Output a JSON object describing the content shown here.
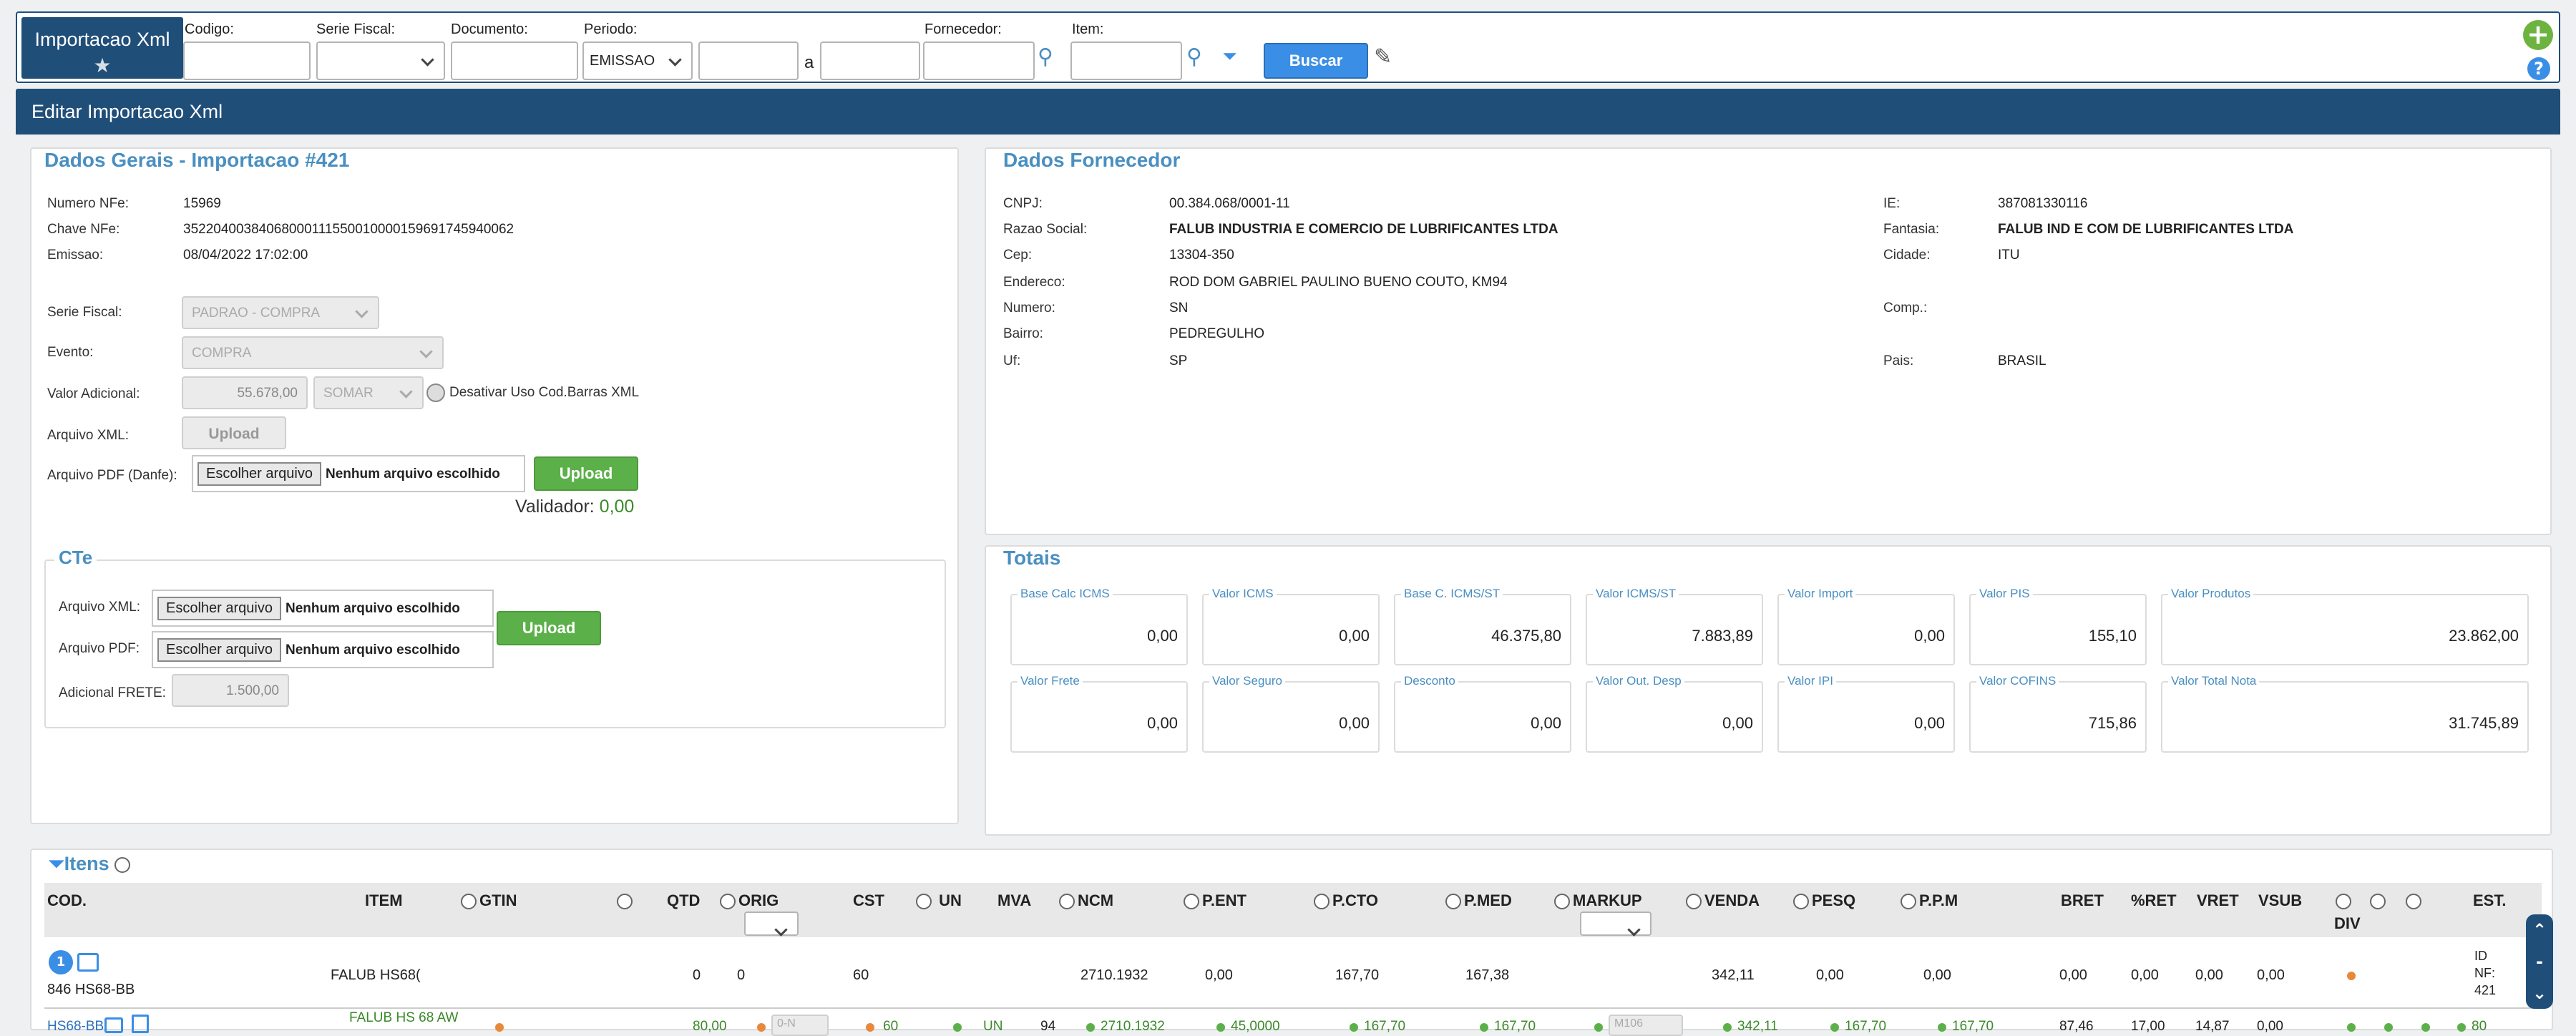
{
  "app": {
    "title": "Importacao Xml"
  },
  "filters": {
    "codigo_label": "Codigo:",
    "serie_label": "Serie Fiscal:",
    "documento_label": "Documento:",
    "periodo_label": "Periodo:",
    "periodo_value": "EMISSAO",
    "a_label": "a",
    "fornecedor_label": "Fornecedor:",
    "item_label": "Item:",
    "buscar": "Buscar"
  },
  "header": {
    "title": "Editar Importacao Xml"
  },
  "dados_gerais": {
    "title": "Dados Gerais - Importacao #421",
    "numero_label": "Numero NFe:",
    "numero": "15969",
    "chave_label": "Chave NFe:",
    "chave": "35220400384068000111550010000159691745940062",
    "emissao_label": "Emissao:",
    "emissao": "08/04/2022 17:02:00",
    "serie_label": "Serie Fiscal:",
    "serie": "PADRAO - COMPRA",
    "evento_label": "Evento:",
    "evento": "COMPRA",
    "valor_adic_label": "Valor Adicional:",
    "valor_adic": "55.678,00",
    "somar": "SOMAR",
    "desativar": "Desativar Uso Cod.Barras XML",
    "arquivo_xml_label": "Arquivo XML:",
    "upload": "Upload",
    "arquivo_pdf_label": "Arquivo PDF (Danfe):",
    "choose": "Escolher arquivo",
    "none": "Nenhum arquivo escolhido",
    "validador_label": "Validador:",
    "validador": "0,00"
  },
  "cte": {
    "title": "CTe",
    "xml_label": "Arquivo XML:",
    "pdf_label": "Arquivo PDF:",
    "frete_label": "Adicional FRETE:",
    "frete": "1.500,00",
    "upload": "Upload"
  },
  "fornecedor": {
    "title": "Dados Fornecedor",
    "cnpj_label": "CNPJ:",
    "cnpj": "00.384.068/0001-11",
    "razao_label": "Razao Social:",
    "razao": "FALUB INDUSTRIA E COMERCIO DE LUBRIFICANTES LTDA",
    "cep_label": "Cep:",
    "cep": "13304-350",
    "end_label": "Endereco:",
    "end": "ROD DOM GABRIEL PAULINO BUENO COUTO, KM94",
    "numero_label": "Numero:",
    "numero": "SN",
    "bairro_label": "Bairro:",
    "bairro": "PEDREGULHO",
    "uf_label": "Uf:",
    "uf": "SP",
    "ie_label": "IE:",
    "ie": "387081330116",
    "fantasia_label": "Fantasia:",
    "fantasia": "FALUB IND E COM DE LUBRIFICANTES LTDA",
    "cidade_label": "Cidade:",
    "cidade": "ITU",
    "comp_label": "Comp.:",
    "pais_label": "Pais:",
    "pais": "BRASIL"
  },
  "totais": {
    "title": "Totais",
    "boxes": [
      {
        "label": "Base Calc ICMS",
        "value": "0,00"
      },
      {
        "label": "Valor ICMS",
        "value": "0,00"
      },
      {
        "label": "Base C. ICMS/ST",
        "value": "46.375,80"
      },
      {
        "label": "Valor ICMS/ST",
        "value": "7.883,89"
      },
      {
        "label": "Valor Import",
        "value": "0,00"
      },
      {
        "label": "Valor PIS",
        "value": "155,10"
      },
      {
        "label": "Valor Produtos",
        "value": "23.862,00"
      },
      {
        "label": "Valor Frete",
        "value": "0,00"
      },
      {
        "label": "Valor Seguro",
        "value": "0,00"
      },
      {
        "label": "Desconto",
        "value": "0,00"
      },
      {
        "label": "Valor Out. Desp",
        "value": "0,00"
      },
      {
        "label": "Valor IPI",
        "value": "0,00"
      },
      {
        "label": "Valor COFINS",
        "value": "715,86"
      },
      {
        "label": "Valor Total Nota",
        "value": "31.745,89"
      }
    ]
  },
  "itens": {
    "title": "Itens",
    "columns": [
      "COD.",
      "ITEM",
      "GTIN",
      "QTD",
      "ORIG",
      "CST",
      "UN",
      "MVA",
      "NCM",
      "P.ENT",
      "P.CTO",
      "P.MED",
      "MARKUP",
      "VENDA",
      "PESQ",
      "P.P.M",
      "BRET",
      "%RET",
      "VRET",
      "VSUB",
      "DIV",
      "EST."
    ],
    "row1": {
      "badge": "1",
      "cod": "846 HS68-BB",
      "item": "FALUB HS68(",
      "gtin": "0",
      "qtd": "0",
      "cst": "60",
      "ncm": "2710.1932",
      "pent": "0,00",
      "pcto": "167,70",
      "pmed": "167,38",
      "venda": "342,11",
      "pesq": "0,00",
      "ppm": "0,00",
      "bret": "0,00",
      "pret": "0,00",
      "vret": "0,00",
      "vsub": "0,00",
      "est": "ID\nNF:\n421"
    },
    "row2": {
      "cod": "HS68-BB",
      "item": "FALUB HS 68 AW",
      "qtd": "80,00",
      "orig": "0-N",
      "cst": "60",
      "un": "UN",
      "mva": "94",
      "ncm": "2710.1932",
      "pent": "45,0000",
      "pcto": "167,70",
      "pmed": "167,70",
      "markup": "M106",
      "venda": "342,11",
      "pesq": "167,70",
      "ppm": "167,70",
      "bret": "87,46",
      "pret": "17,00",
      "vret": "14,87",
      "vsub": "0,00",
      "est": "80"
    }
  },
  "colors": {
    "primary": "#1f4e79",
    "accent": "#4a8fc1",
    "green": "#5cb04a",
    "orange": "#e8893a"
  }
}
